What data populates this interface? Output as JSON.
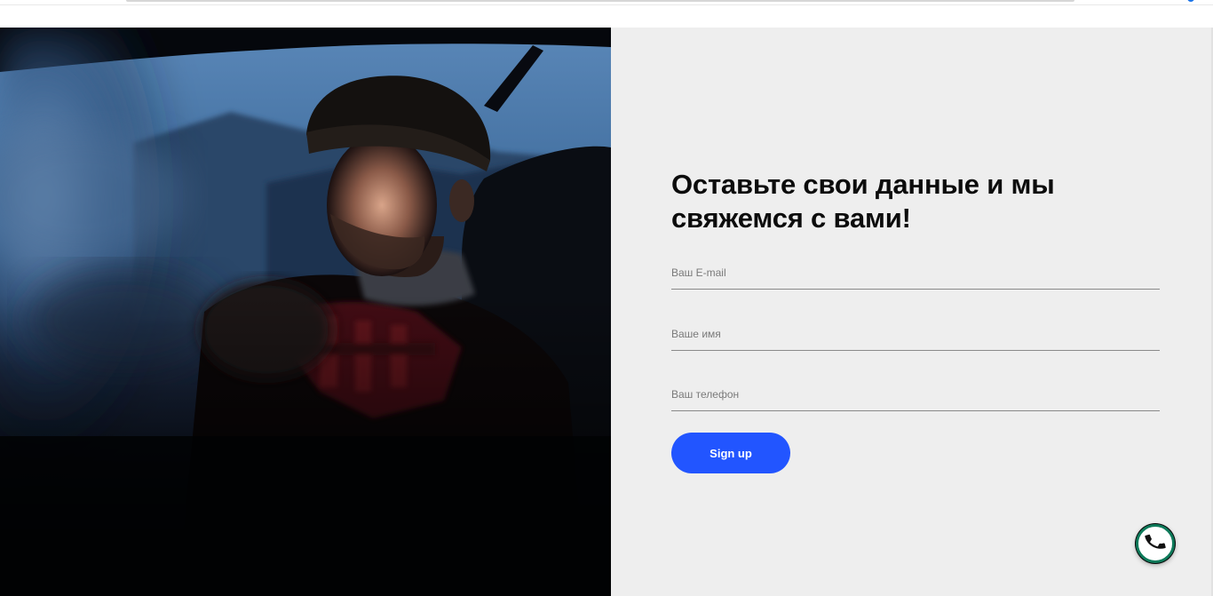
{
  "form": {
    "title": "Оставьте свои данные и мы свяжемся с вами!",
    "fields": [
      {
        "placeholder": "Ваш E-mail",
        "value": ""
      },
      {
        "placeholder": "Ваше имя",
        "value": ""
      },
      {
        "placeholder": "Ваш телефон",
        "value": ""
      }
    ],
    "submit_label": "Sign up"
  },
  "colors": {
    "accent": "#2255ff",
    "panel_background": "#eeeeee",
    "call_ring": "#0e7a5a"
  },
  "icons": {
    "call": "phone-icon"
  }
}
